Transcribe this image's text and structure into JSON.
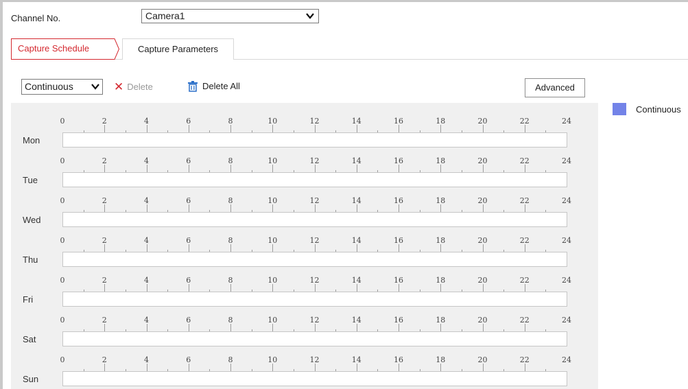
{
  "channel": {
    "label": "Channel No.",
    "value": "Camera1"
  },
  "tabs": [
    {
      "label": "Capture Schedule",
      "active": true
    },
    {
      "label": "Capture Parameters",
      "active": false
    }
  ],
  "toolbar": {
    "mode_value": "Continuous",
    "delete_label": "Delete",
    "delete_all_label": "Delete All",
    "advanced_label": "Advanced"
  },
  "schedule": {
    "days": [
      "Mon",
      "Tue",
      "Wed",
      "Thu",
      "Fri",
      "Sat",
      "Sun"
    ],
    "hour_labels": [
      "0",
      "2",
      "4",
      "6",
      "8",
      "10",
      "12",
      "14",
      "16",
      "18",
      "20",
      "22",
      "24"
    ]
  },
  "legend": {
    "label": "Continuous",
    "color": "#7383e8"
  },
  "colors": {
    "accent": "#d4282f",
    "continuous": "#7383e8"
  }
}
